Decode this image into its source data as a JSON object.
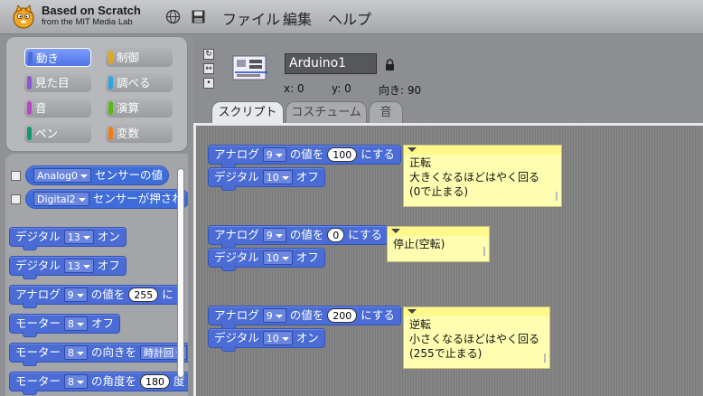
{
  "app": {
    "brand_title": "Based on Scratch",
    "brand_subtitle": "from the MIT Media Lab"
  },
  "menu": {
    "file": "ファイル",
    "edit": "編集",
    "help": "ヘルプ"
  },
  "categories": [
    {
      "label": "動き",
      "color": "#4a6cd4",
      "selected": true
    },
    {
      "label": "制御",
      "color": "#e1a91a",
      "selected": false
    },
    {
      "label": "見た目",
      "color": "#8a55d7",
      "selected": false
    },
    {
      "label": "調べる",
      "color": "#2ca5e2",
      "selected": false
    },
    {
      "label": "音",
      "color": "#bb42c3",
      "selected": false
    },
    {
      "label": "演算",
      "color": "#5cb712",
      "selected": false
    },
    {
      "label": "ペン",
      "color": "#0e9a6c",
      "selected": false
    },
    {
      "label": "変数",
      "color": "#ee7d16",
      "selected": false
    }
  ],
  "palette": {
    "sensor1": {
      "dropdown": "Analog0",
      "text": "センサーの値"
    },
    "sensor2": {
      "dropdown": "Digital2",
      "text": "センサーが押され"
    },
    "b1": {
      "label": "デジタル",
      "pin": "13",
      "state": "オン"
    },
    "b2": {
      "label": "デジタル",
      "pin": "13",
      "state": "オフ"
    },
    "b3": {
      "label": "アナログ",
      "pin": "9",
      "mid": "の値を",
      "value": "255",
      "tail": "に"
    },
    "b4": {
      "label": "モーター",
      "pin": "8",
      "state": "オフ"
    },
    "b5": {
      "label": "モーター",
      "pin": "8",
      "mid": "の向きを",
      "dir": "時計回"
    },
    "b6": {
      "label": "モーター",
      "pin": "8",
      "mid": "の角度を",
      "value": "180",
      "tail": "度"
    }
  },
  "sprite": {
    "name": "Arduino1",
    "x_label": "x: 0",
    "y_label": "y: 0",
    "dir_label": "向き: 90"
  },
  "tabs": [
    "スクリプト",
    "コスチューム",
    "音"
  ],
  "scripts": [
    {
      "analog": {
        "label": "アナログ",
        "pin": "9",
        "mid": "の値を",
        "value": "100",
        "tail": "にする"
      },
      "digital": {
        "label": "デジタル",
        "pin": "10",
        "state": "オフ"
      },
      "comment": [
        "正転",
        "大きくなるほどはやく回る",
        "(0で止まる)"
      ]
    },
    {
      "analog": {
        "label": "アナログ",
        "pin": "9",
        "mid": "の値を",
        "value": "0",
        "tail": "にする"
      },
      "digital": {
        "label": "デジタル",
        "pin": "10",
        "state": "オフ"
      },
      "comment": [
        "停止(空転)"
      ]
    },
    {
      "analog": {
        "label": "アナログ",
        "pin": "9",
        "mid": "の値を",
        "value": "200",
        "tail": "にする"
      },
      "digital": {
        "label": "デジタル",
        "pin": "10",
        "state": "オン"
      },
      "comment": [
        "逆転",
        "小さくなるほどはやく回る",
        "(255で止まる)"
      ]
    }
  ]
}
